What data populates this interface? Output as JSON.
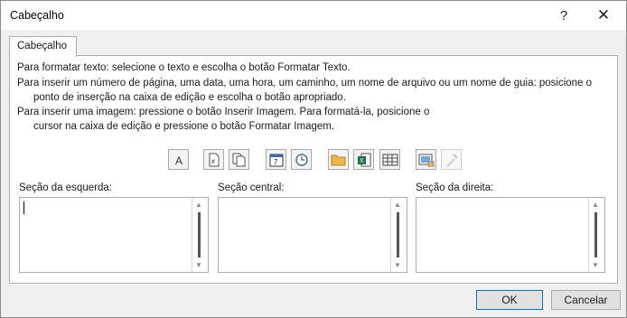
{
  "dialog": {
    "title": "Cabeçalho",
    "help_label": "?",
    "close_label": "✕"
  },
  "tab": {
    "label": "Cabeçalho"
  },
  "instructions": {
    "line1": "Para formatar texto: selecione o texto e escolha o botão Formatar Texto.",
    "line2": "Para inserir um número de página, uma data, uma hora, um caminho, um nome de arquivo ou um nome de guia: posicione o",
    "line3": "ponto de inserção na caixa de edição e escolha o botão apropriado.",
    "line4": "Para inserir uma imagem: pressione o botão Inserir Imagem. Para formatá-la, posicione o",
    "line5": "cursor na caixa de edição e pressione o botão Formatar Imagem."
  },
  "toolbar": [
    {
      "name": "format-text-icon",
      "glyph": "A",
      "enabled": true
    },
    {
      "name": "insert-page-number-icon",
      "glyph": "#",
      "enabled": true
    },
    {
      "name": "insert-page-count-icon",
      "glyph": "⧉",
      "enabled": true
    },
    {
      "name": "insert-date-icon",
      "glyph": "7",
      "enabled": true
    },
    {
      "name": "insert-time-icon",
      "glyph": "◷",
      "enabled": true
    },
    {
      "name": "insert-file-path-icon",
      "glyph": "📂",
      "enabled": true
    },
    {
      "name": "insert-file-name-icon",
      "glyph": "X",
      "enabled": true
    },
    {
      "name": "insert-sheet-name-icon",
      "glyph": "▦",
      "enabled": true
    },
    {
      "name": "insert-picture-icon",
      "glyph": "▣",
      "enabled": true
    },
    {
      "name": "format-picture-icon",
      "glyph": "✎",
      "enabled": false
    }
  ],
  "sections": {
    "left_label": "Seção da esquerda:",
    "center_label": "Seção central:",
    "right_label": "Seção da direita:",
    "left_value": "",
    "center_value": "",
    "right_value": ""
  },
  "buttons": {
    "ok": "OK",
    "cancel": "Cancelar"
  }
}
